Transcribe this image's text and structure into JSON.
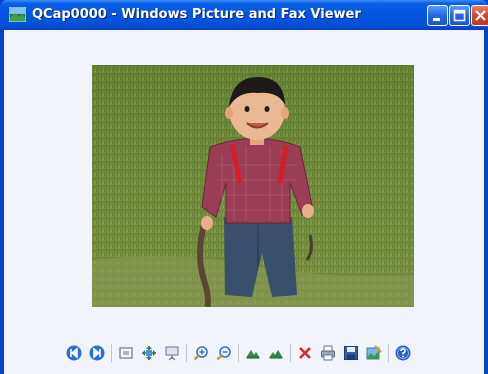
{
  "window": {
    "title": "QCap0000 - Windows Picture and Fax Viewer"
  },
  "toolbar": {
    "buttons": [
      {
        "name": "previous-image-button",
        "icon": "previous-icon"
      },
      {
        "name": "next-image-button",
        "icon": "next-icon"
      },
      {
        "name": "best-fit-button",
        "icon": "best-fit-icon"
      },
      {
        "name": "actual-size-button",
        "icon": "actual-size-icon"
      },
      {
        "name": "slideshow-button",
        "icon": "slideshow-icon"
      },
      {
        "name": "zoom-in-button",
        "icon": "zoom-in-icon"
      },
      {
        "name": "zoom-out-button",
        "icon": "zoom-out-icon"
      },
      {
        "name": "rotate-clockwise-button",
        "icon": "rotate-clockwise-icon"
      },
      {
        "name": "rotate-counterclockwise-button",
        "icon": "rotate-counterclockwise-icon"
      },
      {
        "name": "delete-button",
        "icon": "delete-icon"
      },
      {
        "name": "print-button",
        "icon": "print-icon"
      },
      {
        "name": "save-button",
        "icon": "save-icon"
      },
      {
        "name": "open-for-editing-button",
        "icon": "edit-icon"
      },
      {
        "name": "help-button",
        "icon": "help-icon"
      }
    ]
  },
  "colors": {
    "titlebar": "#0554e0",
    "client_background": "#f1f4fa",
    "close_button": "#d3472a"
  }
}
